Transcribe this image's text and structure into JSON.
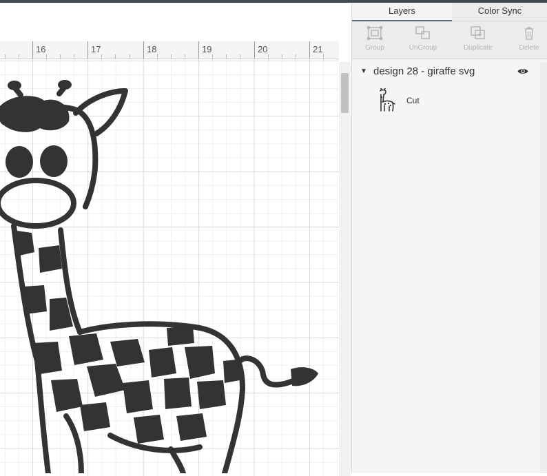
{
  "ruler": {
    "numbers": [
      "16",
      "17",
      "18",
      "19",
      "20",
      "21"
    ]
  },
  "canvas": {
    "design": "giraffe",
    "stroke_color": "#333333",
    "grid_minor_color": "#e3e3e3",
    "grid_major_color": "#c9c9c9"
  },
  "panel": {
    "tabs": [
      {
        "label": "Layers",
        "active": true
      },
      {
        "label": "Color Sync",
        "active": false
      }
    ],
    "toolbar": [
      {
        "label": "Group",
        "icon": "group-icon",
        "enabled": false
      },
      {
        "label": "UnGroup",
        "icon": "ungroup-icon",
        "enabled": false
      },
      {
        "label": "Duplicate",
        "icon": "duplicate-icon",
        "enabled": false
      },
      {
        "label": "Delete",
        "icon": "trash-icon",
        "enabled": false
      }
    ],
    "layer": {
      "name": "design 28 - giraffe svg",
      "expanded": true,
      "visible": true,
      "child": {
        "label": "Cut",
        "thumbnail": "giraffe-thumbnail"
      }
    }
  }
}
